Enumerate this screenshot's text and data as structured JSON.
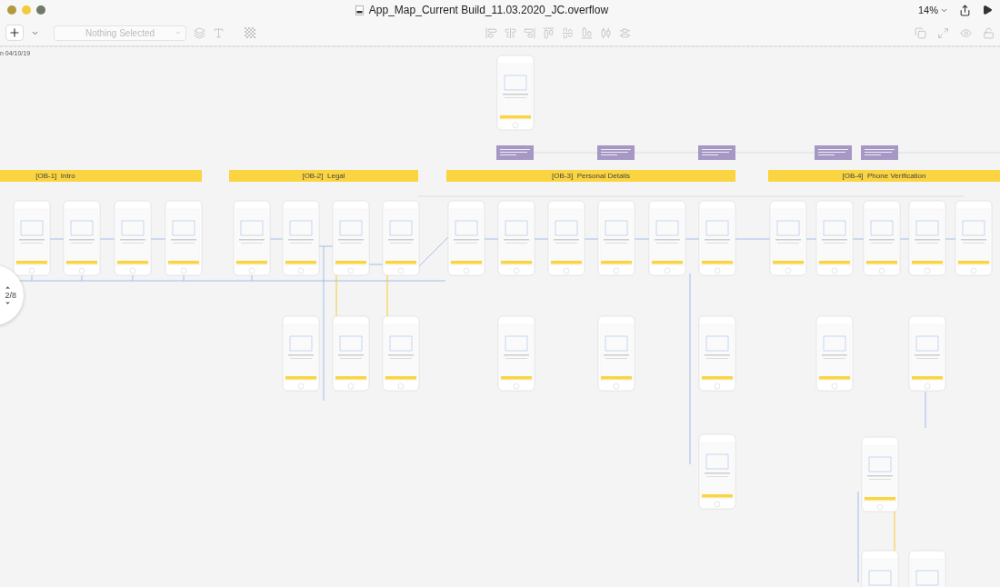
{
  "window": {
    "title": "App_Map_Current Build_11.03.2020_JC.overflow",
    "zoom": "14%"
  },
  "toolbar": {
    "selection": {
      "placeholder": "Nothing Selected"
    }
  },
  "canvas": {
    "note": "n 04/10/19",
    "sections": [
      {
        "label": "[OB-1]  Intro"
      },
      {
        "label": "[OB-2]  Legal"
      },
      {
        "label": "[OB-3]  Personal Details"
      },
      {
        "label": "[OB-4]  Phone Verification"
      }
    ],
    "pager": {
      "label": "2/8"
    }
  }
}
